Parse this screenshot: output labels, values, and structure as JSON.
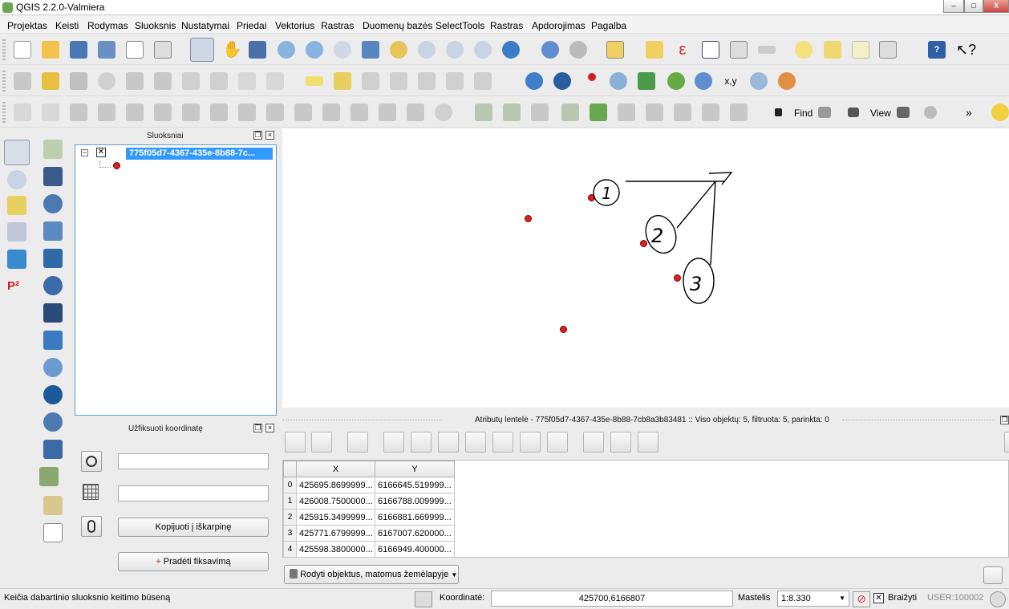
{
  "window": {
    "title": "QGIS 2.2.0-Valmiera",
    "min": "–",
    "max": "□",
    "close": "X"
  },
  "menu": [
    "Projektas",
    "Keisti",
    "Rodymas",
    "Sluoksnis",
    "Nustatymai",
    "Priedai",
    "Vektorius",
    "Rastras",
    "Duomenų bazės",
    "SelectTools",
    "Rastras",
    "Apdorojimas",
    "Pagalba"
  ],
  "toolbar3": {
    "find_label": "Find",
    "view_label": "View",
    "more": "»"
  },
  "layers_panel": {
    "title": "Sluoksniai",
    "layer_name": "775f05d7-4367-435e-8b88-7c..."
  },
  "coord_panel": {
    "title": "Užfiksuoti koordinatę",
    "field1_value": "",
    "field2_value": "",
    "copy_button": "Kopijuoti į iškarpinę",
    "start_button": "Pradėti fiksavimą"
  },
  "attribute_table": {
    "title": "Atributų lentelė - 775f05d7-4367-435e-8b88-7cb8a3b83481 :: Viso objektų: 5, filtruota: 5, parinkta: 0",
    "columns": [
      "X",
      "Y"
    ],
    "rows": [
      {
        "idx": "0",
        "x": "425695.8699999...",
        "y": "6166645.519999..."
      },
      {
        "idx": "1",
        "x": "426008.7500000...",
        "y": "6166788.009999..."
      },
      {
        "idx": "2",
        "x": "425915.3499999...",
        "y": "6166881.669999..."
      },
      {
        "idx": "3",
        "x": "425771.6799999...",
        "y": "6167007.620000..."
      },
      {
        "idx": "4",
        "x": "425598.3800000...",
        "y": "6166949.400000..."
      }
    ],
    "filter_button": "Rodyti objektus, matomus žemėlapyje"
  },
  "statusbar": {
    "message": "Keičia dabartinio sluoksnio keitimo būseną",
    "coord_label": "Koordinatė:",
    "coord_value": "425700,6166807",
    "scale_label": "Mastelis",
    "scale_value": "1:8.330",
    "render_label": "Braižyti",
    "user_label": "USER:100002"
  },
  "map_annotations": {
    "label1": "1",
    "label2": "2",
    "label3": "3"
  },
  "colors": {
    "selection": "#3399ff",
    "point": "#e02020"
  }
}
